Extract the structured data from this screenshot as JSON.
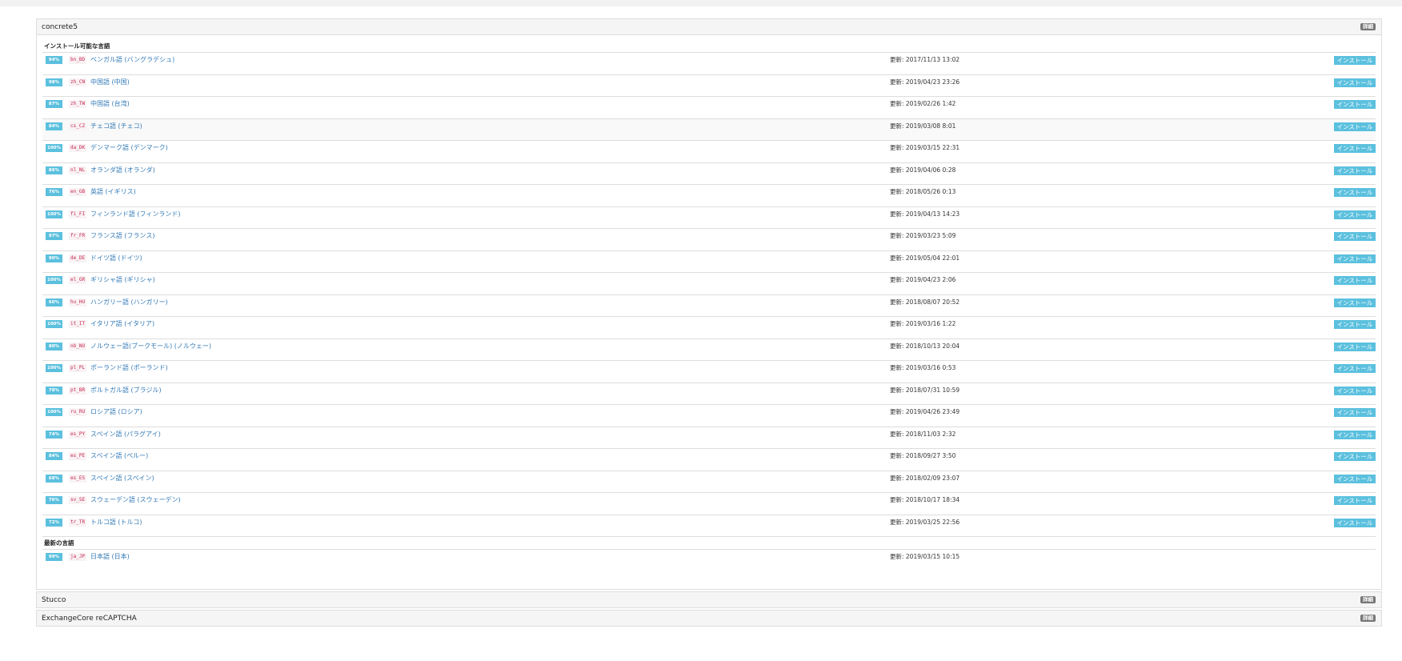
{
  "packages": [
    {
      "title": "concrete5",
      "details_label": "詳細"
    },
    {
      "title": "Stucco",
      "details_label": "詳細"
    },
    {
      "title": "ExchangeCore reCAPTCHA",
      "details_label": "詳細"
    }
  ],
  "installable_heading": "インストール可能な言語",
  "latest_heading": "最新の言語",
  "install_label": "インストール",
  "installable": [
    {
      "pct": "94%",
      "code": "bn_BD",
      "name": "ベンガル語 (バングラデシュ)",
      "updated": "更新: 2017/11/13 13:02"
    },
    {
      "pct": "98%",
      "code": "zh_CN",
      "name": "中国語 (中国)",
      "updated": "更新: 2019/04/23 23:26"
    },
    {
      "pct": "87%",
      "code": "zh_TW",
      "name": "中国語 (台湾)",
      "updated": "更新: 2019/02/26 1:42"
    },
    {
      "pct": "84%",
      "code": "cs_CZ",
      "name": "チェコ語 (チェコ)",
      "updated": "更新: 2019/03/08 8:01"
    },
    {
      "pct": "100%",
      "code": "da_DK",
      "name": "デンマーク語 (デンマーク)",
      "updated": "更新: 2019/03/15 22:31"
    },
    {
      "pct": "86%",
      "code": "nl_NL",
      "name": "オランダ語 (オランダ)",
      "updated": "更新: 2019/04/06 0:28"
    },
    {
      "pct": "76%",
      "code": "en_GB",
      "name": "英語 (イギリス)",
      "updated": "更新: 2018/05/26 0:13"
    },
    {
      "pct": "100%",
      "code": "fi_FI",
      "name": "フィンランド語 (フィンランド)",
      "updated": "更新: 2019/04/13 14:23"
    },
    {
      "pct": "97%",
      "code": "fr_FR",
      "name": "フランス語 (フランス)",
      "updated": "更新: 2019/03/23 5:09"
    },
    {
      "pct": "90%",
      "code": "de_DE",
      "name": "ドイツ語 (ドイツ)",
      "updated": "更新: 2019/05/04 22:01"
    },
    {
      "pct": "100%",
      "code": "el_GR",
      "name": "ギリシャ語 (ギリシャ)",
      "updated": "更新: 2019/04/23 2:06"
    },
    {
      "pct": "60%",
      "code": "hu_HU",
      "name": "ハンガリー語 (ハンガリー)",
      "updated": "更新: 2018/08/07 20:52"
    },
    {
      "pct": "100%",
      "code": "it_IT",
      "name": "イタリア語 (イタリア)",
      "updated": "更新: 2019/03/16 1:22"
    },
    {
      "pct": "80%",
      "code": "nb_NO",
      "name": "ノルウェー語(ブークモール) (ノルウェー)",
      "updated": "更新: 2018/10/13 20:04"
    },
    {
      "pct": "100%",
      "code": "pl_PL",
      "name": "ポーランド語 (ポーランド)",
      "updated": "更新: 2019/03/16 0:53"
    },
    {
      "pct": "78%",
      "code": "pt_BR",
      "name": "ポルトガル語 (ブラジル)",
      "updated": "更新: 2018/07/31 10:59"
    },
    {
      "pct": "100%",
      "code": "ru_RU",
      "name": "ロシア語 (ロシア)",
      "updated": "更新: 2019/04/26 23:49"
    },
    {
      "pct": "74%",
      "code": "es_PY",
      "name": "スペイン語 (パラグアイ)",
      "updated": "更新: 2018/11/03 2:32"
    },
    {
      "pct": "84%",
      "code": "es_PE",
      "name": "スペイン語 (ペルー)",
      "updated": "更新: 2018/09/27 3:50"
    },
    {
      "pct": "68%",
      "code": "es_ES",
      "name": "スペイン語 (スペイン)",
      "updated": "更新: 2018/02/09 23:07"
    },
    {
      "pct": "76%",
      "code": "sv_SE",
      "name": "スウェーデン語 (スウェーデン)",
      "updated": "更新: 2018/10/17 18:34"
    },
    {
      "pct": "72%",
      "code": "tr_TR",
      "name": "トルコ語 (トルコ)",
      "updated": "更新: 2019/03/25 22:56"
    }
  ],
  "latest": [
    {
      "pct": "99%",
      "code": "ja_JP",
      "name": "日本語 (日本)",
      "updated": "更新: 2019/03/15 10:15"
    }
  ],
  "colors": {
    "info": "#5bc0de",
    "link": "#337ab7",
    "code_text": "#c7254e",
    "code_bg": "#f9f2f4",
    "details_bg": "#777777"
  }
}
